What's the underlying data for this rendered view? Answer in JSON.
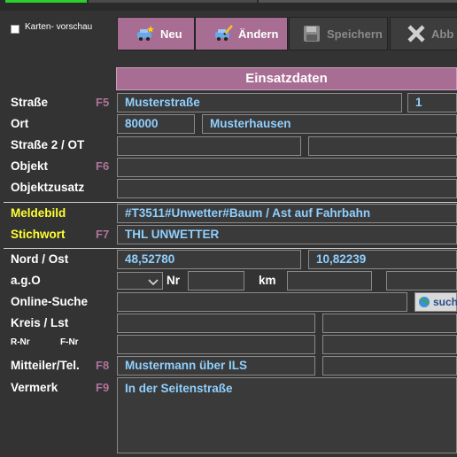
{
  "preview": {
    "label": "Karten- vorschau",
    "checked": false
  },
  "toolbar": {
    "neu": "Neu",
    "aendern": "Ändern",
    "speichern": "Speichern",
    "abbrechen": "Abb"
  },
  "section": {
    "title": "Einsatzdaten"
  },
  "labels": {
    "strasse": "Straße",
    "ort": "Ort",
    "strasse2": "Straße 2 / OT",
    "objekt": "Objekt",
    "objektzusatz": "Objektzusatz",
    "meldebild": "Meldebild",
    "stichwort": "Stichwort",
    "nord_ost": "Nord / Ost",
    "ago": "a.g.O",
    "nr": "Nr",
    "km": "km",
    "online_suche": "Online-Suche",
    "kreis": "Kreis / Lst",
    "rnr": "R-Nr",
    "fnr": "F-Nr",
    "mitteiler": "Mitteiler/Tel.",
    "vermerk": "Vermerk"
  },
  "fkeys": {
    "strasse": "F5",
    "objekt": "F6",
    "stichwort": "F7",
    "mitteiler": "F8",
    "vermerk": "F9"
  },
  "fields": {
    "strasse": "Musterstraße",
    "hausnr": "1",
    "plz": "80000",
    "ort": "Musterhausen",
    "meldebild": "#T3511#Unwetter#Baum / Ast auf Fahrbahn",
    "stichwort": "THL UNWETTER",
    "nord": "48,52780",
    "ost": "10,82239",
    "mitteiler": "Mustermann über ILS",
    "vermerk": "In der Seitenstraße"
  },
  "search_button": "such"
}
